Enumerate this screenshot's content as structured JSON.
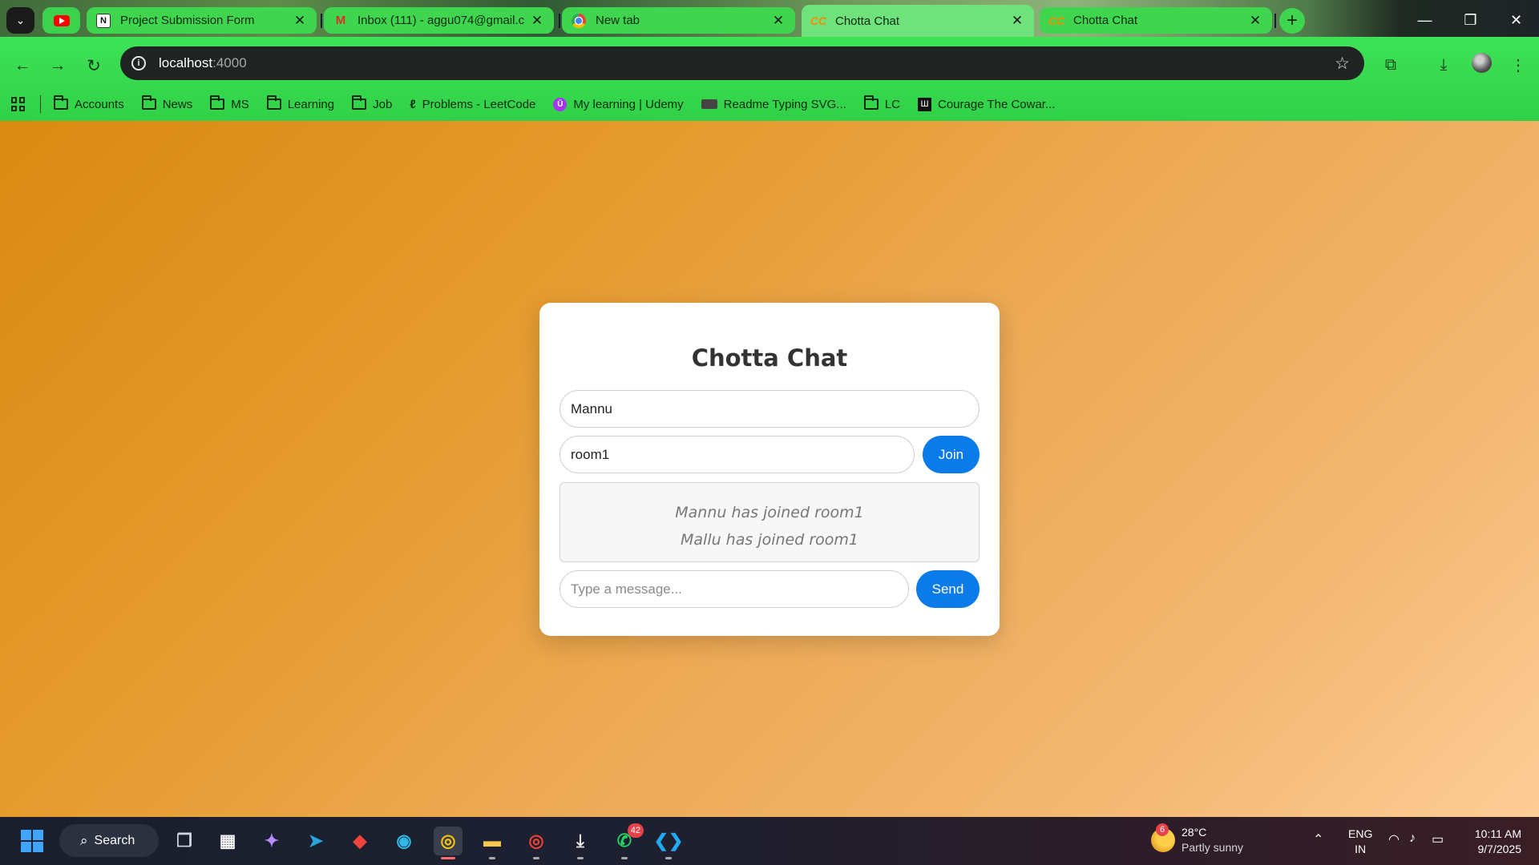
{
  "browser": {
    "tabs": [
      {
        "title": "Project Submission Form",
        "icon": "notion-icon"
      },
      {
        "title": "Inbox (111) - aggu074@gmail.c",
        "icon": "gmail-icon"
      },
      {
        "title": "New tab",
        "icon": "chrome-icon"
      },
      {
        "title": "Chotta Chat",
        "icon": "chotta-chat-icon",
        "active": true
      },
      {
        "title": "Chotta Chat",
        "icon": "chotta-chat-icon"
      }
    ],
    "url": {
      "host": "localhost",
      "port": ":4000"
    },
    "bookmarks": [
      {
        "label": "Accounts",
        "icon": "folder-icon"
      },
      {
        "label": "News",
        "icon": "folder-icon"
      },
      {
        "label": "MS",
        "icon": "folder-icon"
      },
      {
        "label": "Learning",
        "icon": "folder-icon"
      },
      {
        "label": "Job",
        "icon": "folder-icon"
      },
      {
        "label": "Problems - LeetCode",
        "icon": "leetcode-icon"
      },
      {
        "label": "My learning | Udemy",
        "icon": "udemy-icon"
      },
      {
        "label": "Readme Typing SVG...",
        "icon": "keyboard-icon"
      },
      {
        "label": "LC",
        "icon": "folder-icon"
      },
      {
        "label": "Courage The Cowar...",
        "icon": "museum-icon"
      }
    ],
    "accent_color": "#3de356"
  },
  "app": {
    "title": "Chotta Chat",
    "username_value": "Mannu",
    "room_value": "room1",
    "join_label": "Join",
    "messages": [
      "Mannu has joined room1",
      "Mallu has joined room1"
    ],
    "message_placeholder": "Type a message...",
    "send_label": "Send",
    "button_color": "#0b7be9"
  },
  "taskbar": {
    "search_label": "Search",
    "whatsapp_badge": "42",
    "weather_badge": "6",
    "temperature": "28°C",
    "weather": "Partly sunny",
    "lang_line1": "ENG",
    "lang_line2": "IN",
    "time": "10:11 AM",
    "date": "9/7/2025"
  }
}
